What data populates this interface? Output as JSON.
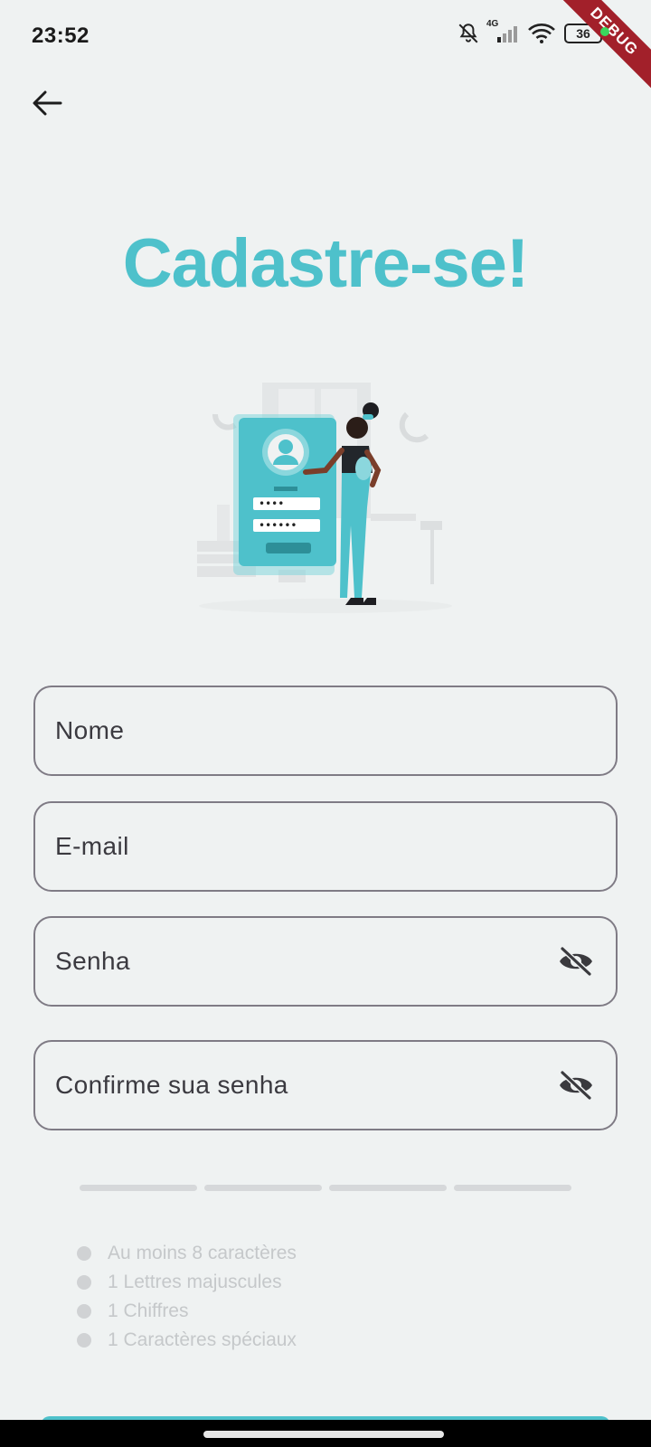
{
  "status_bar": {
    "time": "23:52",
    "network": "4G",
    "battery": "36",
    "icons": [
      "bell-off-icon",
      "signal-icon",
      "wifi-icon",
      "battery-icon"
    ]
  },
  "debug_banner": "DEBUG",
  "header": {
    "back_icon": "arrow-left-icon",
    "title": "Cadastre-se!"
  },
  "form": {
    "fields": [
      {
        "placeholder": "Nome"
      },
      {
        "placeholder": "E-mail"
      },
      {
        "placeholder": "Senha",
        "trailing_icon": "eye-off-icon"
      },
      {
        "placeholder": "Confirme sua senha",
        "trailing_icon": "eye-off-icon"
      }
    ],
    "strength_segments_filled": 0,
    "strength_segments_total": 4,
    "rules": [
      "Au moins 8 caractères",
      "1 Lettres majuscules",
      "1 Chiffres",
      "1 Caractères spéciaux"
    ]
  },
  "colors": {
    "accent": "#4ec1cb",
    "background": "#eff2f2",
    "field_border": "#7f7b85",
    "rule_inactive": "#c5c8ca"
  }
}
